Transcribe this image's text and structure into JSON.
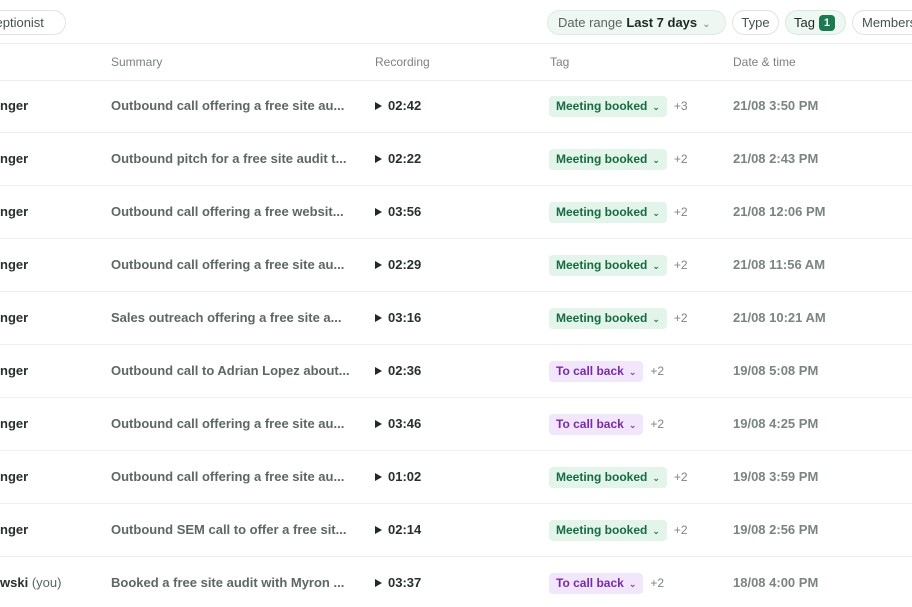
{
  "filters": {
    "agent_chip": "ceptionist",
    "date_range_label": "Date range",
    "date_range_value": "Last 7 days",
    "type_label": "Type",
    "tag_label": "Tag",
    "tag_count": "1",
    "members_label": "Members"
  },
  "columns": {
    "summary": "Summary",
    "recording": "Recording",
    "tag": "Tag",
    "datetime": "Date & time"
  },
  "rows": [
    {
      "agent": "nger",
      "you": "",
      "summary": "Outbound call offering a free site au...",
      "duration": "02:42",
      "tag": "Meeting booked",
      "tag_color": "green",
      "more": "+3",
      "datetime": "21/08 3:50 PM"
    },
    {
      "agent": "nger",
      "you": "",
      "summary": "Outbound pitch for a free site audit t...",
      "duration": "02:22",
      "tag": "Meeting booked",
      "tag_color": "green",
      "more": "+2",
      "datetime": "21/08 2:43 PM"
    },
    {
      "agent": "nger",
      "you": "",
      "summary": "Outbound call offering a free websit...",
      "duration": "03:56",
      "tag": "Meeting booked",
      "tag_color": "green",
      "more": "+2",
      "datetime": "21/08 12:06 PM"
    },
    {
      "agent": "nger",
      "you": "",
      "summary": "Outbound call offering a free site au...",
      "duration": "02:29",
      "tag": "Meeting booked",
      "tag_color": "green",
      "more": "+2",
      "datetime": "21/08 11:56 AM"
    },
    {
      "agent": "nger",
      "you": "",
      "summary": "Sales outreach offering a free site a...",
      "duration": "03:16",
      "tag": "Meeting booked",
      "tag_color": "green",
      "more": "+2",
      "datetime": "21/08 10:21 AM"
    },
    {
      "agent": "nger",
      "you": "",
      "summary": "Outbound call to Adrian Lopez about...",
      "duration": "02:36",
      "tag": "To call back",
      "tag_color": "purple",
      "more": "+2",
      "datetime": "19/08 5:08 PM"
    },
    {
      "agent": "nger",
      "you": "",
      "summary": "Outbound call offering a free site au...",
      "duration": "03:46",
      "tag": "To call back",
      "tag_color": "purple",
      "more": "+2",
      "datetime": "19/08 4:25 PM"
    },
    {
      "agent": "nger",
      "you": "",
      "summary": "Outbound call offering a free site au...",
      "duration": "01:02",
      "tag": "Meeting booked",
      "tag_color": "green",
      "more": "+2",
      "datetime": "19/08 3:59 PM"
    },
    {
      "agent": "nger",
      "you": "",
      "summary": "Outbound SEM call to offer a free sit...",
      "duration": "02:14",
      "tag": "Meeting booked",
      "tag_color": "green",
      "more": "+2",
      "datetime": "19/08 2:56 PM"
    },
    {
      "agent": "wski",
      "you": "(you)",
      "summary": "Booked a free site audit with Myron ...",
      "duration": "03:37",
      "tag": "To call back",
      "tag_color": "purple",
      "more": "+2",
      "datetime": "18/08 4:00 PM"
    }
  ],
  "colors": {
    "meeting_booked_bg": "#e3f4ea",
    "meeting_booked_text": "#166b43",
    "call_back_bg": "#f1e6fb",
    "call_back_text": "#7a2aa8",
    "tag_count_badge": "#1b7a4f"
  },
  "icons": {
    "play": "play-icon",
    "chevron": "chevron-down-icon"
  }
}
